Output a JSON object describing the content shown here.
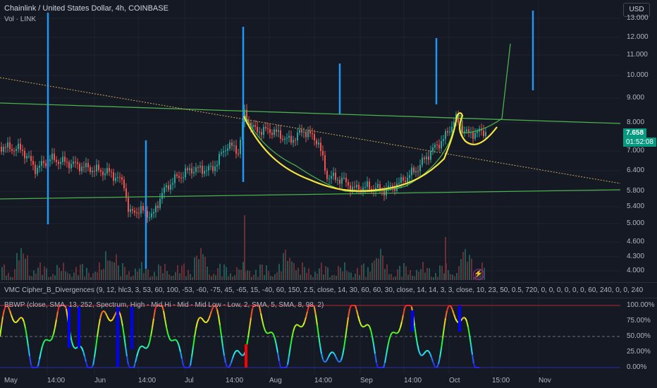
{
  "header": {
    "symbol_title": "Chainlink / United States Dollar, 4h, COINBASE",
    "volume_label": "Vol · LINK",
    "currency": "USD"
  },
  "indicators": {
    "vmc": "VMC Cipher_B_Divergences (9, 12, hlc3, 3, 53, 60, 100, -53, -60, -75, 45, -65, 15, -40, 60, 150, 2.5, close, 14, 30, 60, 60, 30, close, 14, 14, 3, 3, close, 10, 23, 50, 0.5, 720, 0, 0, 0, 0, 0, 0, 60, 240, 0, 0, 240",
    "bbwp": "BBWP (close, SMA, 13, 252, Spectrum, High - Mid Hi - Mid - Mid Low - Low, 2, SMA, 5, SMA, 8, 98, 2)"
  },
  "price_axis": [
    "13.000",
    "12.000",
    "11.000",
    "10.000",
    "9.000",
    "8.000",
    "7.000",
    "6.400",
    "5.800",
    "5.400",
    "5.000",
    "4.600",
    "4.300",
    "4.000"
  ],
  "last_price": {
    "value": "7.658",
    "countdown": "01:52:08"
  },
  "bbwp_axis": [
    "100.00%",
    "75.00%",
    "50.00%",
    "25.00%",
    "0.00%"
  ],
  "time_axis": [
    "May",
    "14:00",
    "Jun",
    "14:00",
    "Jul",
    "14:00",
    "Aug",
    "14:00",
    "Sep",
    "14:00",
    "Oct",
    "15:00",
    "Nov"
  ],
  "colors": {
    "background": "#151924",
    "up_candle": "#26a69a",
    "down_candle": "#ef5350",
    "trendline": "#4caf50",
    "cup_handle": "#f5e642",
    "vertical_marker": "#2196f3",
    "last_price_tag": "#089981",
    "bbwp_extreme_high": "#ff0000",
    "bbwp_extreme_low": "#0000ff"
  },
  "icons": {
    "flash": "lightning-icon"
  },
  "chart_data": {
    "type": "line",
    "symbol": "LINK/USD",
    "timeframe": "4h",
    "x": [
      "May",
      "Jun",
      "Jul",
      "Aug",
      "Sep",
      "Oct"
    ],
    "series": [
      {
        "name": "LINK",
        "values": [
          6.9,
          5.1,
          8.3,
          6.4,
          5.9,
          7.66
        ]
      },
      {
        "name": "BBWP",
        "values": [
          60,
          40,
          95,
          75,
          70,
          25
        ]
      }
    ],
    "ylim": [
      4.0,
      13.0
    ],
    "bbwp_ylim": [
      0,
      100
    ],
    "annotations": [
      "resistance-line",
      "support-line",
      "dotted-trendline",
      "cup-and-handle",
      "projection"
    ]
  }
}
